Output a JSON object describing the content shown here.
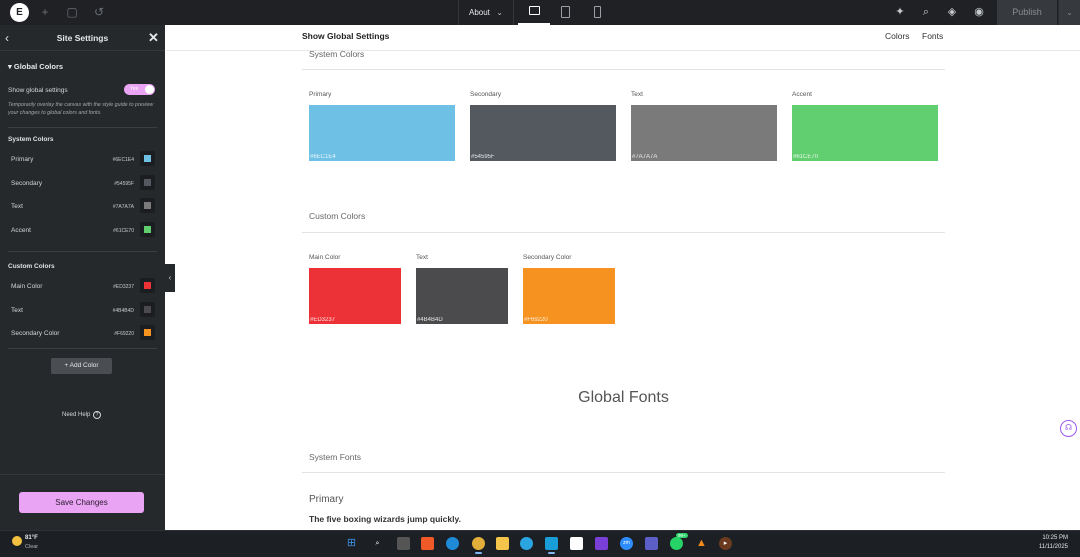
{
  "topbar": {
    "page_menu_label": "About",
    "publish_label": "Publish"
  },
  "sidebar": {
    "title": "Site Settings",
    "section_title": "Global Colors",
    "show_global_label": "Show global settings",
    "toggle_label": "Yes",
    "description": "Temporarily overlay the canvas with the style guide to preview your changes to global colors and fonts.",
    "system_colors_title": "System Colors",
    "system_colors": [
      {
        "name": "Primary",
        "hex": "#6EC1E4",
        "color": "#6EC1E4"
      },
      {
        "name": "Secondary",
        "hex": "#54595F",
        "color": "#54595F"
      },
      {
        "name": "Text",
        "hex": "#7A7A7A",
        "color": "#7A7A7A"
      },
      {
        "name": "Accent",
        "hex": "#61CE70",
        "color": "#61CE70"
      }
    ],
    "custom_colors_title": "Custom Colors",
    "custom_colors": [
      {
        "name": "Main Color",
        "hex": "#ED3237",
        "color": "#ED3237"
      },
      {
        "name": "Text",
        "hex": "#4B4B4D",
        "color": "#4B4B4D"
      },
      {
        "name": "Secondary Color",
        "hex": "#F69220",
        "color": "#F69220"
      }
    ],
    "add_color_label": "+  Add Color",
    "need_help_label": "Need Help",
    "save_label": "Save Changes"
  },
  "canvas": {
    "title": "Show Global Settings",
    "tab_colors": "Colors",
    "tab_fonts": "Fonts",
    "system_colors_heading": "System Colors",
    "system_swatches": [
      {
        "label": "Primary",
        "hex": "#6EC1E4",
        "color": "#6EC1E4"
      },
      {
        "label": "Secondary",
        "hex": "#54595F",
        "color": "#54595F"
      },
      {
        "label": "Text",
        "hex": "#7A7A7A",
        "color": "#7A7A7A"
      },
      {
        "label": "Accent",
        "hex": "#61CE70",
        "color": "#61CE70"
      }
    ],
    "custom_colors_heading": "Custom Colors",
    "custom_swatches": [
      {
        "label": "Main Color",
        "hex": "#ED3237",
        "color": "#ED3237"
      },
      {
        "label": "Text",
        "hex": "#4B4B4D",
        "color": "#4B4B4D"
      },
      {
        "label": "Secondary Color",
        "hex": "#F69220",
        "color": "#F69220"
      }
    ],
    "global_fonts_title": "Global Fonts",
    "system_fonts_heading": "System Fonts",
    "font_primary_name": "Primary",
    "font_sample": "The five boxing wizards jump quickly."
  },
  "taskbar": {
    "temperature": "81°F",
    "condition": "Clear",
    "time": "10:25 PM",
    "date": "11/11/2025",
    "apps": [
      "windows-start-icon",
      "search-icon",
      "task-view-icon",
      "brave-browser-icon",
      "edge-browser-icon",
      "chrome-browser-icon",
      "file-explorer-icon",
      "telegram-icon",
      "notepad-icon",
      "capcut-icon",
      "video-editor-icon",
      "zoom-icon",
      "teams-icon",
      "whatsapp-icon",
      "vlc-icon",
      "media-player-icon"
    ],
    "whatsapp_badge": "99+"
  },
  "colors": {
    "sidebar_bg": "#26292C",
    "topbar_bg": "#1F2124",
    "accent_pink": "#E9A4F3"
  }
}
